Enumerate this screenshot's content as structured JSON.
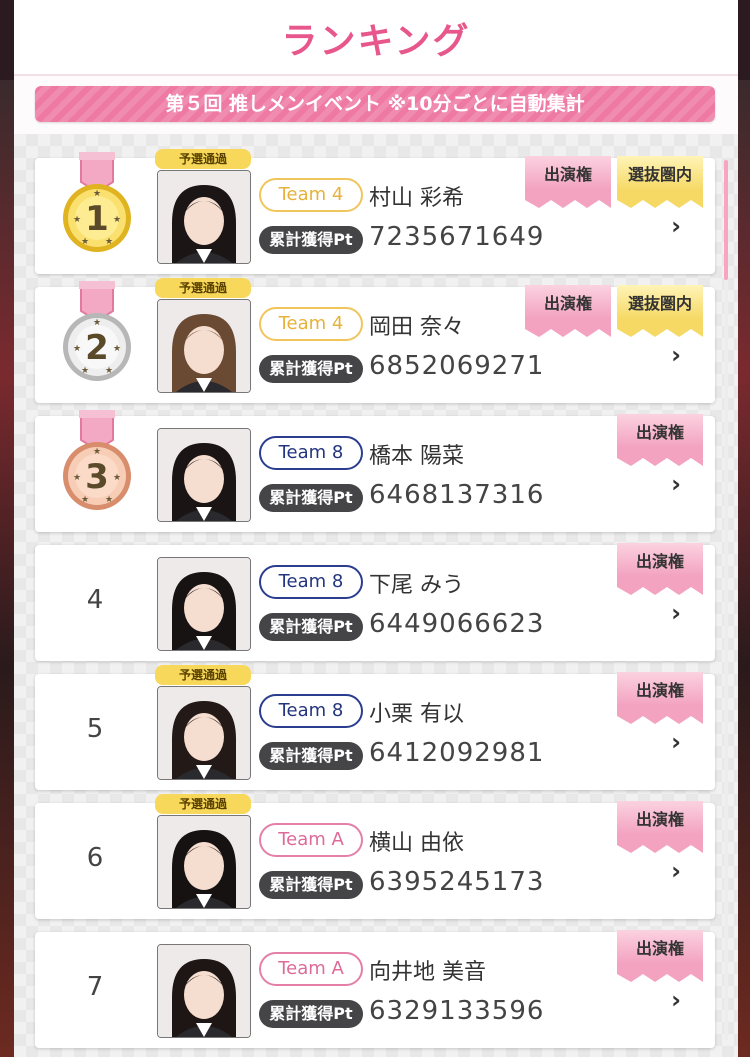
{
  "header": {
    "title": "ランキング"
  },
  "banner": {
    "text": "第５回 推しメンイベント ※10分ごとに自動集計"
  },
  "labels": {
    "pt_badge": "累計獲得Pt",
    "yosen": "予選通過",
    "shutsuen": "出演権",
    "senbatsu": "選抜圏内",
    "chevron": "›"
  },
  "colors": {
    "accent": "#e8578c",
    "banner": "#ee79a2",
    "team4": "#f1c55c",
    "team8": "#2b3d8f",
    "teamA": "#e57fa8",
    "gold_medal": "#f6d64b",
    "silver_medal": "#d8d8d8",
    "bronze_medal": "#efb89c"
  },
  "entries": [
    {
      "rank": "1",
      "medal": "gold",
      "team": "Team 4",
      "name": "村山 彩希",
      "points": "7235671649",
      "yosen": true,
      "shutsuen": true,
      "senbatsu": true
    },
    {
      "rank": "2",
      "medal": "silver",
      "team": "Team 4",
      "name": "岡田 奈々",
      "points": "6852069271",
      "yosen": true,
      "shutsuen": true,
      "senbatsu": true
    },
    {
      "rank": "3",
      "medal": "bronze",
      "team": "Team 8",
      "name": "橋本 陽菜",
      "points": "6468137316",
      "yosen": false,
      "shutsuen": true,
      "senbatsu": false
    },
    {
      "rank": "4",
      "medal": null,
      "team": "Team 8",
      "name": "下尾 みう",
      "points": "6449066623",
      "yosen": false,
      "shutsuen": true,
      "senbatsu": false
    },
    {
      "rank": "5",
      "medal": null,
      "team": "Team 8",
      "name": "小栗 有以",
      "points": "6412092981",
      "yosen": true,
      "shutsuen": true,
      "senbatsu": false
    },
    {
      "rank": "6",
      "medal": null,
      "team": "Team A",
      "name": "横山 由依",
      "points": "6395245173",
      "yosen": true,
      "shutsuen": true,
      "senbatsu": false
    },
    {
      "rank": "7",
      "medal": null,
      "team": "Team A",
      "name": "向井地 美音",
      "points": "6329133596",
      "yosen": false,
      "shutsuen": true,
      "senbatsu": false
    }
  ]
}
